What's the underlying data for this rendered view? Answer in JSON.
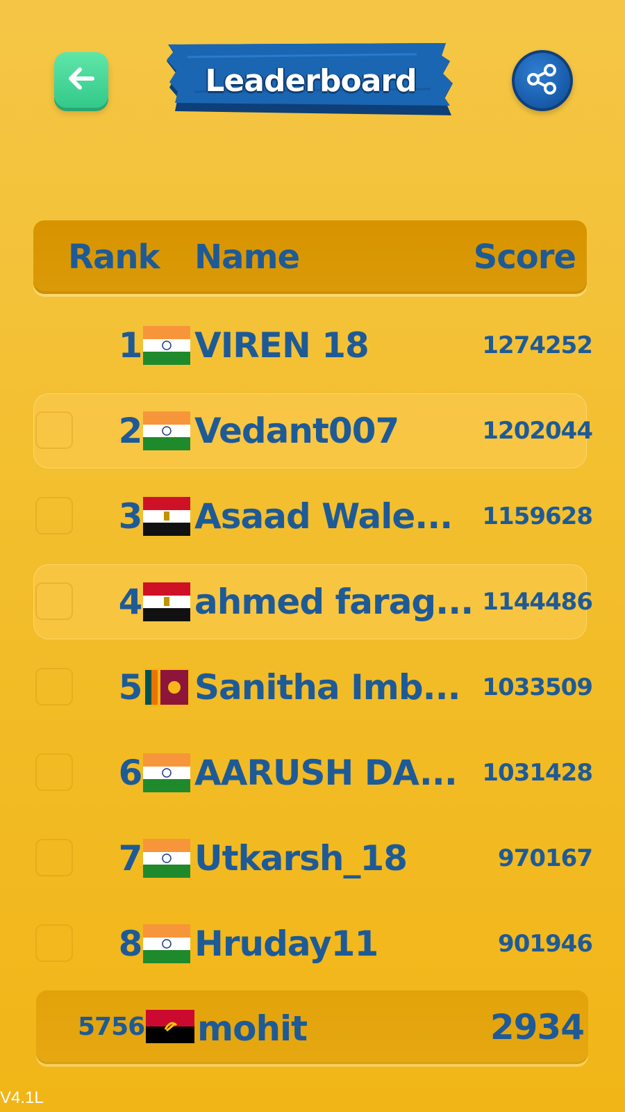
{
  "header": {
    "title": "Leaderboard",
    "back_icon": "arrow-left-icon",
    "share_icon": "share-icon"
  },
  "colors": {
    "background": "#f3bf2e",
    "text_blue": "#1e5a96",
    "back_button": "#3fd494",
    "banner_blue": "#1a64b0"
  },
  "table": {
    "headers": {
      "rank": "Rank",
      "name": "Name",
      "score": "Score"
    },
    "rows": [
      {
        "rank": "1",
        "flag": "india-flag-icon",
        "name": "VIREN 18",
        "score": "1274252"
      },
      {
        "rank": "2",
        "flag": "india-flag-icon",
        "name": "Vedant007",
        "score": "1202044"
      },
      {
        "rank": "3",
        "flag": "egypt-flag-icon",
        "name": "Asaad Wale...",
        "score": "1159628"
      },
      {
        "rank": "4",
        "flag": "egypt-flag-icon",
        "name": "ahmed farag...",
        "score": "1144486"
      },
      {
        "rank": "5",
        "flag": "sri-lanka-flag-icon",
        "name": "Sanitha Imb...",
        "score": "1033509"
      },
      {
        "rank": "6",
        "flag": "india-flag-icon",
        "name": "AARUSH DA...",
        "score": "1031428"
      },
      {
        "rank": "7",
        "flag": "india-flag-icon",
        "name": "Utkarsh_18",
        "score": "970167"
      },
      {
        "rank": "8",
        "flag": "india-flag-icon",
        "name": "Hruday11",
        "score": "901946"
      }
    ]
  },
  "my_entry": {
    "rank": "5756",
    "flag": "angola-flag-icon",
    "name": "mohit",
    "score": "2934"
  },
  "version": "V4.1L"
}
